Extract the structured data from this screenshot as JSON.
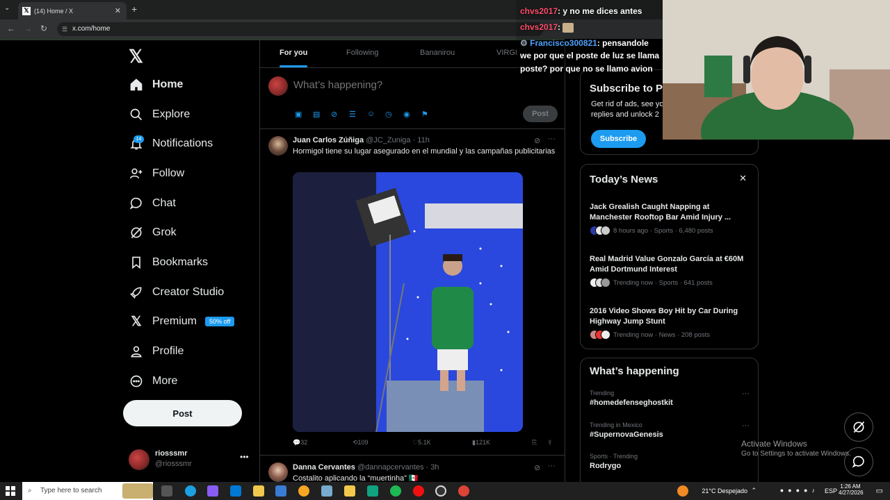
{
  "browser": {
    "tab_title": "(14) Home / X",
    "url": "x.com/home"
  },
  "nav": {
    "items": [
      {
        "label": "Home",
        "icon": "home-icon"
      },
      {
        "label": "Explore",
        "icon": "search-icon"
      },
      {
        "label": "Notifications",
        "icon": "bell-icon"
      },
      {
        "label": "Follow",
        "icon": "follow-icon"
      },
      {
        "label": "Chat",
        "icon": "chat-icon"
      },
      {
        "label": "Grok",
        "icon": "grok-icon"
      },
      {
        "label": "Bookmarks",
        "icon": "bookmark-icon"
      },
      {
        "label": "Creator Studio",
        "icon": "rocket-icon"
      },
      {
        "label": "Premium",
        "icon": "x-icon"
      },
      {
        "label": "Profile",
        "icon": "person-icon"
      },
      {
        "label": "More",
        "icon": "more-circle-icon"
      }
    ],
    "notif_count": "14",
    "premium_badge": "50% off",
    "post_button": "Post"
  },
  "account": {
    "name": "riosssmr",
    "handle": "@riosssmr"
  },
  "feed_tabs": [
    "For you",
    "Following",
    "Bananirou",
    "VIRGI"
  ],
  "composer": {
    "placeholder": "What’s happening?",
    "post_label": "Post"
  },
  "tweets": [
    {
      "name": "Juan Carlos Zúñiga",
      "meta": "@JC_Zuniga · 11h",
      "text": "Hormigol tiene su lugar asegurado en el mundial y las campañas publicitarias",
      "replies": "32",
      "reposts": "109",
      "likes": "5.1K",
      "views": "121K"
    },
    {
      "name": "Danna Cervantes",
      "meta": "@dannapcervantes · 3h",
      "text": "Costalito aplicando la “muertinha” 🇲🇽"
    }
  ],
  "subscribe": {
    "title": "Subscribe to P",
    "text1": "Get rid of ads, see yo",
    "text2": "replies and unlock 2",
    "button": "Subscribe"
  },
  "news": {
    "title": "Today’s News",
    "items": [
      {
        "headline": "Jack Grealish Caught Napping at Manchester Rooftop Bar Amid Injury ...",
        "meta": "8 hours ago · Sports · 6,480 posts"
      },
      {
        "headline": "Real Madrid Value Gonzalo García at €60M Amid Dortmund Interest",
        "meta": "Trending now · Sports · 641 posts"
      },
      {
        "headline": "2016 Video Shows Boy Hit by Car During Highway Jump Stunt",
        "meta": "Trending now · News · 208 posts"
      }
    ]
  },
  "happening": {
    "title": "What’s happening",
    "trends": [
      {
        "category": "Trending",
        "name": "#homedefenseghostkit"
      },
      {
        "category": "Trending in Mexico",
        "name": "#SupernovaGenesis"
      },
      {
        "category": "Sports · Trending",
        "name": "Rodrygo"
      }
    ]
  },
  "stream_chat": [
    {
      "user": "chvs2017",
      "msg": ": y no me dices antes",
      "color": "#ff4d6d"
    },
    {
      "user": "chvs2017",
      "msg": ":",
      "color": "#ff4d6d"
    },
    {
      "user": "Francisco300821",
      "msg": ": pensandole",
      "color": "#4da3ff"
    },
    {
      "user": "",
      "msg": "we por que el poste de luz se llama",
      "color": "#ffffff"
    },
    {
      "user": "",
      "msg": "poste? por que no se llamo avion",
      "color": "#ffffff"
    }
  ],
  "windows": {
    "activate_title": "Activate Windows",
    "activate_sub": "Go to Settings to activate Windows.",
    "search_placeholder": "Type here to search",
    "weather": "21°C  Despejado",
    "lang": "ESP",
    "time": "1:26 AM",
    "date": "4/27/2026"
  },
  "colors": {
    "accent": "#1d9bf0",
    "bg": "#000000",
    "text": "#e7e9ea",
    "muted": "#71767b"
  }
}
